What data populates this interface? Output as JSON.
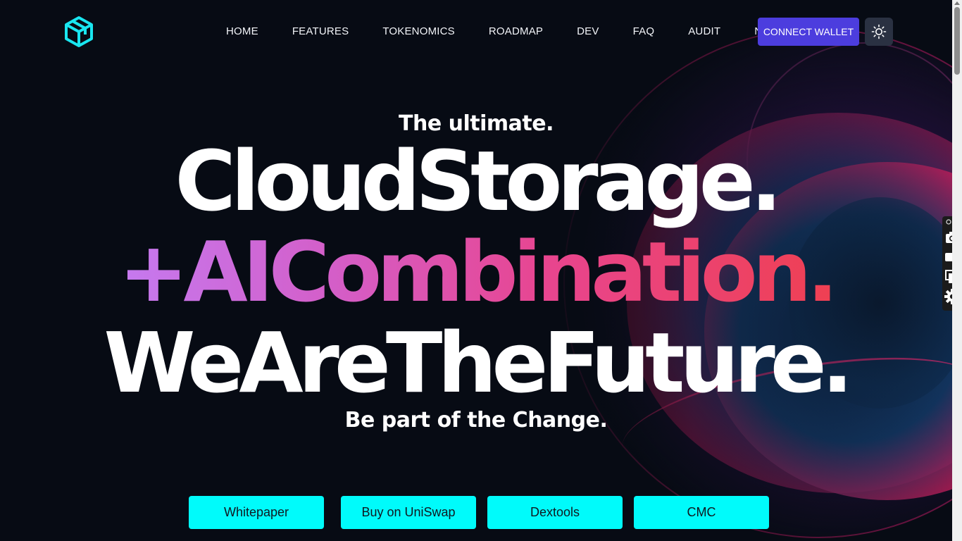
{
  "nav": {
    "items": [
      "HOME",
      "FEATURES",
      "TOKENOMICS",
      "ROADMAP",
      "DEV",
      "FAQ",
      "AUDIT",
      "NFT"
    ],
    "connect_label": "CONNECT WALLET",
    "logo_icon": "cube-logo-icon",
    "theme_icon": "sun-icon"
  },
  "hero": {
    "kicker": "The ultimate.",
    "line1": "CloudStorage.",
    "line2": "+AICombination.",
    "line3": "WeAreTheFuture.",
    "subline": "Be part of the Change."
  },
  "buttons": {
    "whitepaper": "Whitepaper",
    "uniswap": "Buy on UniSwap",
    "dextools": "Dextools",
    "cmc": "CMC"
  },
  "extension_panel": {
    "icons": [
      "extension-icon",
      "camera-icon",
      "video-icon",
      "copy-icon",
      "settings-icon"
    ]
  },
  "colors": {
    "background": "#070b14",
    "accent_cyan": "#00fbfb",
    "connect_purple": "#4c3dde",
    "gradient_start": "#c57af0",
    "gradient_end": "#ef4052"
  }
}
